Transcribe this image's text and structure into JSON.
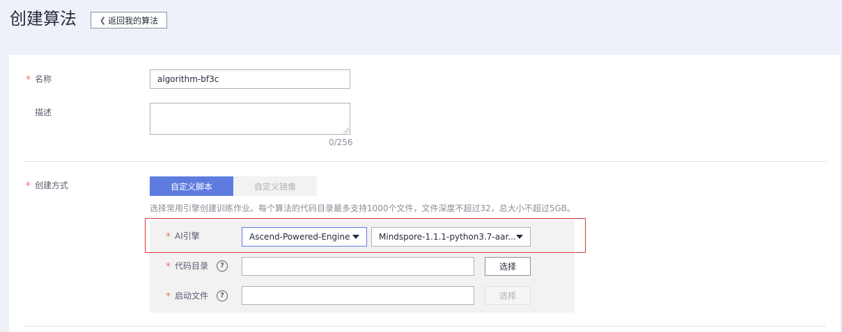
{
  "header": {
    "title": "创建算法",
    "back_label": "返回我的算法"
  },
  "form": {
    "name": {
      "label": "名称",
      "value": "algorithm-bf3c"
    },
    "description": {
      "label": "描述",
      "value": "",
      "counter": "0/256"
    },
    "create_mode": {
      "label": "创建方式",
      "tabs": [
        {
          "label": "自定义脚本",
          "active": true
        },
        {
          "label": "自定义镜像",
          "active": false
        }
      ],
      "hint": "选择常用引擎创建训练作业。每个算法的代码目录最多支持1000个文件，文件深度不超过32，总大小不超过5GB。"
    },
    "ai_engine": {
      "label": "AI引擎",
      "engine": "Ascend-Powered-Engine",
      "version": "Mindspore-1.1.1-python3.7-aar..."
    },
    "code_dir": {
      "label": "代码目录",
      "value": "",
      "button": "选择"
    },
    "boot_file": {
      "label": "启动文件",
      "value": "",
      "button": "选择"
    }
  },
  "icons": {
    "back": "chevron-left-icon",
    "help": "question-circle-icon",
    "dropdown": "caret-down-icon"
  },
  "colors": {
    "primary": "#5e7ce0",
    "required": "#f66f6a",
    "highlight_border": "#d33b3b"
  }
}
